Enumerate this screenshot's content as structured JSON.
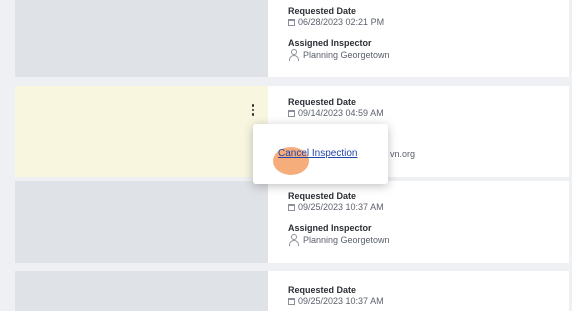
{
  "rows": [
    {
      "requested_label": "Requested Date",
      "requested_value": "06/28/2023 02:21 PM",
      "inspector_label": "Assigned Inspector",
      "inspector_value": "Planning Georgetown"
    },
    {
      "requested_label": "Requested Date",
      "requested_value": "09/14/2023 04:59 AM",
      "inspector_value_partial": "vn.org"
    },
    {
      "requested_label": "Requested Date",
      "requested_value": "09/25/2023 10:37 AM",
      "inspector_label": "Assigned Inspector",
      "inspector_value": "Planning Georgetown"
    },
    {
      "requested_label": "Requested Date",
      "requested_value": "09/25/2023 10:37 AM"
    }
  ],
  "menu": {
    "cancel_inspection": "Cancel Inspection"
  },
  "icons": {
    "calendar": "calendar-icon",
    "person": "person-icon",
    "more": "kebab-menu-icon"
  },
  "colors": {
    "highlight_row": "#f8f6df",
    "link": "#2145a8",
    "click_indicator": "#f29150"
  }
}
